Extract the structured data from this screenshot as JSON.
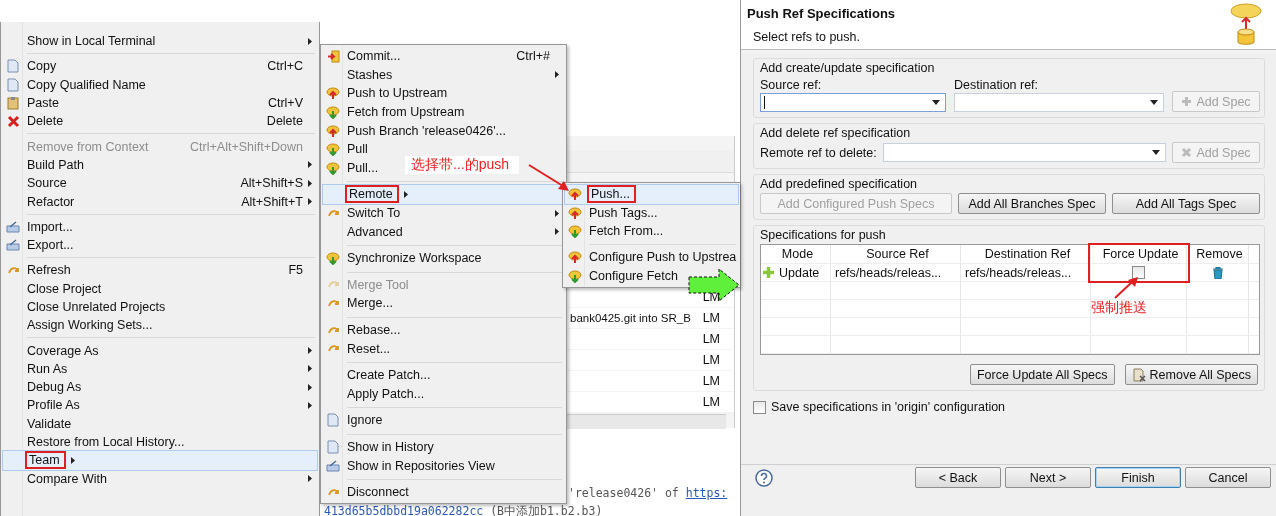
{
  "context_menu": {
    "items": [
      {
        "kind": "item",
        "label": "Show in Local Terminal",
        "submenu": true,
        "disabled": false,
        "selected": false,
        "boxed": false
      },
      {
        "kind": "separator"
      },
      {
        "kind": "page",
        "label": "Copy",
        "shortcut": "Ctrl+C",
        "submenu": false,
        "disabled": false,
        "selected": false,
        "boxed": false
      },
      {
        "kind": "page",
        "label": "Copy Qualified Name",
        "submenu": false,
        "disabled": false,
        "selected": false,
        "boxed": false
      },
      {
        "kind": "clipboard",
        "label": "Paste",
        "shortcut": "Ctrl+V",
        "submenu": false,
        "disabled": false,
        "selected": false,
        "boxed": false
      },
      {
        "kind": "cross",
        "label": "Delete",
        "shortcut": "Delete",
        "submenu": false,
        "disabled": false,
        "selected": false,
        "boxed": false
      },
      {
        "kind": "separator"
      },
      {
        "kind": "item",
        "label": "Remove from Context",
        "shortcut": "Ctrl+Alt+Shift+Down",
        "submenu": false,
        "disabled": true,
        "selected": false,
        "boxed": false
      },
      {
        "kind": "item",
        "label": "Build Path",
        "submenu": true,
        "disabled": false,
        "selected": false,
        "boxed": false
      },
      {
        "kind": "item",
        "label": "Source",
        "shortcut": "Alt+Shift+S",
        "submenu": true,
        "disabled": false,
        "selected": false,
        "boxed": false
      },
      {
        "kind": "item",
        "label": "Refactor",
        "shortcut": "Alt+Shift+T",
        "submenu": true,
        "disabled": false,
        "selected": false,
        "boxed": false
      },
      {
        "kind": "separator"
      },
      {
        "kind": "tray",
        "label": "Import...",
        "submenu": false,
        "disabled": false,
        "selected": false,
        "boxed": false
      },
      {
        "kind": "tray",
        "label": "Export...",
        "submenu": false,
        "disabled": false,
        "selected": false,
        "boxed": false
      },
      {
        "kind": "separator"
      },
      {
        "kind": "arrows",
        "label": "Refresh",
        "shortcut": "F5",
        "submenu": false,
        "disabled": false,
        "selected": false,
        "boxed": false
      },
      {
        "kind": "item",
        "label": "Close Project",
        "submenu": false,
        "disabled": false,
        "selected": false,
        "boxed": false
      },
      {
        "kind": "item",
        "label": "Close Unrelated Projects",
        "submenu": false,
        "disabled": false,
        "selected": false,
        "boxed": false
      },
      {
        "kind": "item",
        "label": "Assign Working Sets...",
        "submenu": false,
        "disabled": false,
        "selected": false,
        "boxed": false
      },
      {
        "kind": "separator"
      },
      {
        "kind": "item",
        "label": "Coverage As",
        "submenu": true,
        "disabled": false,
        "selected": false,
        "boxed": false
      },
      {
        "kind": "item",
        "label": "Run As",
        "submenu": true,
        "disabled": false,
        "selected": false,
        "boxed": false
      },
      {
        "kind": "item",
        "label": "Debug As",
        "submenu": true,
        "disabled": false,
        "selected": false,
        "boxed": false
      },
      {
        "kind": "item",
        "label": "Profile As",
        "submenu": true,
        "disabled": false,
        "selected": false,
        "boxed": false
      },
      {
        "kind": "item",
        "label": "Validate",
        "submenu": false,
        "disabled": false,
        "selected": false,
        "boxed": false
      },
      {
        "kind": "item",
        "label": "Restore from Local History...",
        "submenu": false,
        "disabled": false,
        "selected": false,
        "boxed": false
      },
      {
        "kind": "item",
        "label": "Team",
        "submenu": true,
        "disabled": false,
        "selected": true,
        "boxed": true
      },
      {
        "kind": "item",
        "label": "Compare With",
        "submenu": true,
        "disabled": false,
        "selected": false,
        "boxed": false
      }
    ]
  },
  "team_menu": {
    "items": [
      {
        "kind": "commit",
        "label": "Commit...",
        "shortcut": "Ctrl+#",
        "submenu": false,
        "disabled": false,
        "selected": false,
        "boxed": false
      },
      {
        "kind": "item",
        "label": "Stashes",
        "submenu": true,
        "disabled": false,
        "selected": false,
        "boxed": false
      },
      {
        "kind": "cloud-up",
        "label": "Push to Upstream",
        "submenu": false,
        "disabled": false,
        "selected": false,
        "boxed": false
      },
      {
        "kind": "cloud-down",
        "label": "Fetch from Upstream",
        "submenu": false,
        "disabled": false,
        "selected": false,
        "boxed": false
      },
      {
        "kind": "cloud-up",
        "label": "Push Branch 'release0426'...",
        "submenu": false,
        "disabled": false,
        "selected": false,
        "boxed": false
      },
      {
        "kind": "cloud-down",
        "label": "Pull",
        "submenu": false,
        "disabled": false,
        "selected": false,
        "boxed": false
      },
      {
        "kind": "cloud-down",
        "label": "Pull...",
        "submenu": false,
        "disabled": false,
        "selected": false,
        "boxed": false
      },
      {
        "kind": "separator"
      },
      {
        "kind": "item",
        "label": "Remote",
        "submenu": true,
        "disabled": false,
        "selected": true,
        "boxed": true
      },
      {
        "kind": "arrows",
        "label": "Switch To",
        "submenu": true,
        "disabled": false,
        "selected": false,
        "boxed": false
      },
      {
        "kind": "item",
        "label": "Advanced",
        "submenu": true,
        "disabled": false,
        "selected": false,
        "boxed": false
      },
      {
        "kind": "separator"
      },
      {
        "kind": "cloud-down",
        "label": "Synchronize Workspace",
        "submenu": false,
        "disabled": false,
        "selected": false,
        "boxed": false
      },
      {
        "kind": "separator"
      },
      {
        "kind": "arrows",
        "label": "Merge Tool",
        "submenu": false,
        "disabled": true,
        "selected": false,
        "boxed": false
      },
      {
        "kind": "arrows",
        "label": "Merge...",
        "submenu": false,
        "disabled": false,
        "selected": false,
        "boxed": false
      },
      {
        "kind": "separator"
      },
      {
        "kind": "arrows",
        "label": "Rebase...",
        "submenu": false,
        "disabled": false,
        "selected": false,
        "boxed": false
      },
      {
        "kind": "arrows",
        "label": "Reset...",
        "submenu": false,
        "disabled": false,
        "selected": false,
        "boxed": false
      },
      {
        "kind": "separator"
      },
      {
        "kind": "item",
        "label": "Create Patch...",
        "submenu": false,
        "disabled": false,
        "selected": false,
        "boxed": false
      },
      {
        "kind": "item",
        "label": "Apply Patch...",
        "submenu": false,
        "disabled": false,
        "selected": false,
        "boxed": false
      },
      {
        "kind": "separator"
      },
      {
        "kind": "page",
        "label": "Ignore",
        "submenu": false,
        "disabled": false,
        "selected": false,
        "boxed": false
      },
      {
        "kind": "separator"
      },
      {
        "kind": "page",
        "label": "Show in History",
        "submenu": false,
        "disabled": false,
        "selected": false,
        "boxed": false
      },
      {
        "kind": "tray",
        "label": "Show in Repositories View",
        "submenu": false,
        "disabled": false,
        "selected": false,
        "boxed": false
      },
      {
        "kind": "separator"
      },
      {
        "kind": "arrows",
        "label": "Disconnect",
        "submenu": false,
        "disabled": false,
        "selected": false,
        "boxed": false
      }
    ]
  },
  "remote_menu": {
    "items": [
      {
        "kind": "cloud-up",
        "label": "Push...",
        "disabled": false,
        "selected": true,
        "boxed": true
      },
      {
        "kind": "cloud-up",
        "label": "Push Tags...",
        "disabled": false,
        "selected": false,
        "boxed": false
      },
      {
        "kind": "cloud-down",
        "label": "Fetch From...",
        "disabled": false,
        "selected": false,
        "boxed": false
      },
      {
        "kind": "separator"
      },
      {
        "kind": "cloud-up",
        "label": "Configure Push to Upstrea",
        "disabled": false,
        "selected": false,
        "boxed": false
      },
      {
        "kind": "cloud-down",
        "label": "Configure Fetch",
        "disabled": false,
        "selected": false,
        "boxed": false
      }
    ]
  },
  "history_view": {
    "rows": [
      {
        "author": "LM"
      },
      {
        "message": "bank0425.git into SR_B",
        "author": "LM"
      },
      {
        "author": "LM"
      },
      {
        "author": "LM"
      },
      {
        "author": "LM"
      },
      {
        "author": "LM"
      }
    ],
    "console_lines": [
      {
        "text": "'release0426' of ",
        "link": "https:"
      },
      {
        "link": "413d65b5dbbd19a062282cc",
        "text": " (B中添加b1.b2.b3)"
      }
    ]
  },
  "annotations": [
    {
      "text": "选择带...的push"
    },
    {
      "text": "强制推送"
    }
  ],
  "dialog": {
    "title": "Push Ref Specifications",
    "subtitle": "Select refs to push.",
    "create_group": {
      "title": "Add create/update specification",
      "source_label": "Source ref:",
      "destination_label": "Destination ref:",
      "button": {
        "label": "Add Spec",
        "disabled": true
      }
    },
    "delete_group": {
      "title": "Add delete ref specification",
      "remote_label": "Remote ref to delete:",
      "button": {
        "label": "Add Spec",
        "disabled": true
      }
    },
    "predefined_group": {
      "title": "Add predefined specification",
      "buttons": [
        {
          "label": "Add Configured Push Specs",
          "disabled": true
        },
        {
          "label": "Add All Branches Spec",
          "disabled": false
        },
        {
          "label": "Add All Tags Spec",
          "disabled": false
        }
      ]
    },
    "specs_group": {
      "title": "Specifications for push",
      "columns": [
        {
          "label": "Mode",
          "boxed": false
        },
        {
          "label": "Source Ref",
          "boxed": false
        },
        {
          "label": "Destination Ref",
          "boxed": false
        },
        {
          "label": "Force Update",
          "boxed": true
        },
        {
          "label": "Remove",
          "boxed": false
        }
      ],
      "rows": [
        {
          "mode": "Update",
          "source_ref": "refs/heads/releas...",
          "destination_ref": "refs/heads/releas...",
          "force_update": false
        }
      ],
      "buttons": [
        {
          "label": "Force Update All Specs"
        },
        {
          "label": "Remove All Specs"
        }
      ]
    },
    "save_option": {
      "label": "Save specifications in 'origin' configuration",
      "checked": false
    },
    "footer_buttons": [
      {
        "label": "< Back",
        "default": false
      },
      {
        "label": "Next >",
        "default": false
      },
      {
        "label": "Finish",
        "default": true
      },
      {
        "label": "Cancel",
        "default": false
      }
    ]
  }
}
